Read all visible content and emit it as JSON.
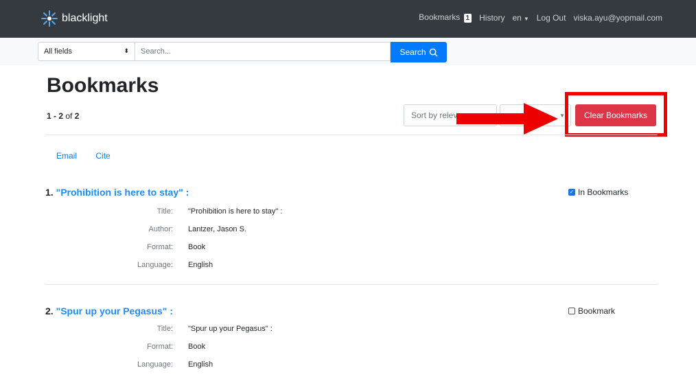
{
  "navbar": {
    "brand": "blacklight",
    "bookmarks_label": "Bookmarks",
    "bookmarks_count": "1",
    "history_label": "History",
    "language": "en",
    "logout_label": "Log Out",
    "user_email": "viska.ayu@yopmail.com"
  },
  "search": {
    "field_value": "All fields",
    "placeholder": "Search...",
    "button_label": "Search"
  },
  "page": {
    "title": "Bookmarks",
    "range": "1 - 2",
    "of": "of",
    "total": "2"
  },
  "controls": {
    "sort_label": "Sort by relevance",
    "clear_label": "Clear Bookmarks"
  },
  "tools": {
    "email": "Email",
    "cite": "Cite"
  },
  "documents": [
    {
      "index": "1.",
      "title_link": "\"Prohibition is here to stay\" :",
      "bookmark_label": "In Bookmarks",
      "bookmarked": true,
      "fields": [
        {
          "label": "Title:",
          "value": "\"Prohibition is here to stay\" :"
        },
        {
          "label": "Author:",
          "value": "Lantzer, Jason S."
        },
        {
          "label": "Format:",
          "value": "Book"
        },
        {
          "label": "Language:",
          "value": "English"
        }
      ]
    },
    {
      "index": "2.",
      "title_link": "\"Spur up your Pegasus\" :",
      "bookmark_label": "Bookmark",
      "bookmarked": false,
      "fields": [
        {
          "label": "Title:",
          "value": "\"Spur up your Pegasus\" :"
        },
        {
          "label": "Format:",
          "value": "Book"
        },
        {
          "label": "Language:",
          "value": "English"
        }
      ]
    }
  ],
  "colors": {
    "navbar": "#343a40",
    "primary": "#007bff",
    "danger": "#dc3545",
    "annotation": "#ee0000"
  }
}
